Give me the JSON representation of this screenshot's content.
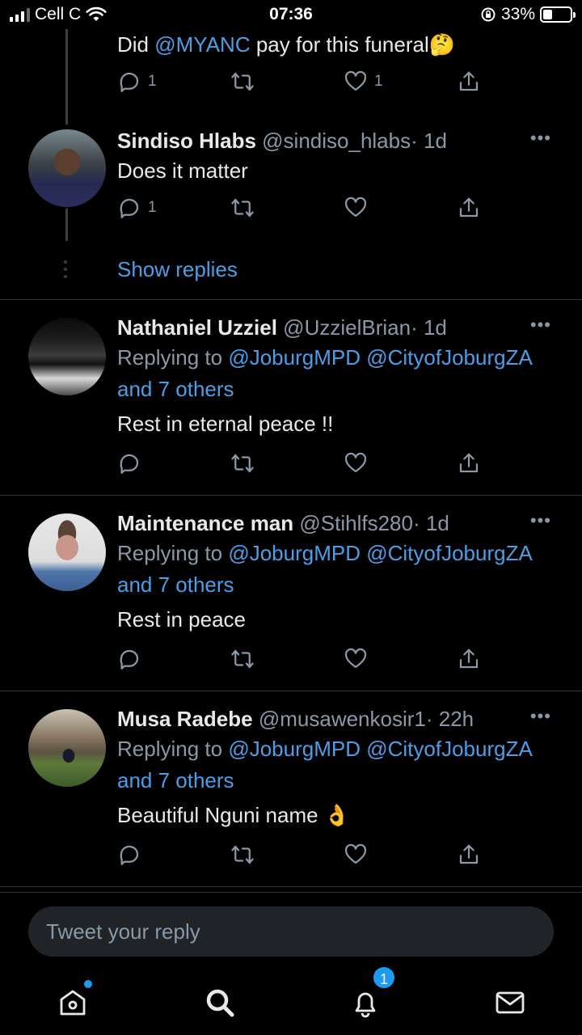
{
  "status_bar": {
    "carrier": "Cell C",
    "time": "07:36",
    "battery_percent": "33%",
    "battery_level": 0.33
  },
  "tweets": [
    {
      "text_prefix": "Did ",
      "mention": "@MYANC",
      "text_suffix": " pay for this funeral",
      "emoji": "🤔",
      "reply_count": "1",
      "like_count": "1"
    },
    {
      "name": "Sindiso Hlabs",
      "handle": "@sindiso_hlabs",
      "time": "· 1d",
      "text": "Does it matter",
      "reply_count": "1"
    },
    {
      "name": "Nathaniel Uzziel",
      "handle": "@UzzielBrian",
      "time": "· 1d",
      "replying_label": "Replying to ",
      "reply_to_1": "@JoburgMPD",
      "reply_to_2": "@CityofJoburgZA",
      "reply_to_others": "and 7 others",
      "text": "Rest in eternal peace !!"
    },
    {
      "name": "Maintenance man",
      "handle": "@Stihlfs280",
      "time": "· 1d",
      "replying_label": "Replying to ",
      "reply_to_1": "@JoburgMPD",
      "reply_to_2": "@CityofJoburgZA",
      "reply_to_others": "and 7 others",
      "text": "Rest in peace"
    },
    {
      "name": "Musa Radebe",
      "handle": "@musawenkosir1",
      "time": "· 22h",
      "replying_label": "Replying to ",
      "reply_to_1": "@JoburgMPD",
      "reply_to_2": "@CityofJoburgZA",
      "reply_to_others": "and 7 others",
      "text": "Beautiful Nguni name",
      "emoji": "👌"
    }
  ],
  "show_replies": "Show replies",
  "reply_bar": {
    "placeholder": "Tweet your reply"
  },
  "tabs": {
    "home_icon": "home-icon",
    "search_icon": "search-icon",
    "notifications_icon": "bell-icon",
    "notifications_count": "1",
    "messages_icon": "mail-icon"
  },
  "colors": {
    "background": "#000000",
    "accent": "#1d9bf0",
    "link": "#4a9fe8",
    "muted": "#8b98a5"
  }
}
